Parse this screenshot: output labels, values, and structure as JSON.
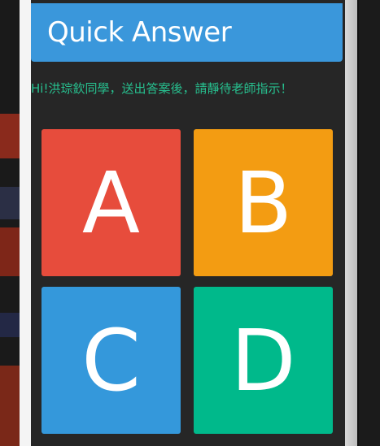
{
  "header": {
    "title": "Quick Answer"
  },
  "greeting": "Hi!洪琮欽同學，送出答案後，請靜待老師指示！",
  "answers": [
    {
      "label": "A",
      "color": "#e74c3c"
    },
    {
      "label": "B",
      "color": "#f39c12"
    },
    {
      "label": "C",
      "color": "#3498db"
    },
    {
      "label": "D",
      "color": "#00b98b"
    }
  ],
  "colors": {
    "header": "#3a97db",
    "greeting_text": "#27c08f",
    "app_background": "#262626"
  }
}
